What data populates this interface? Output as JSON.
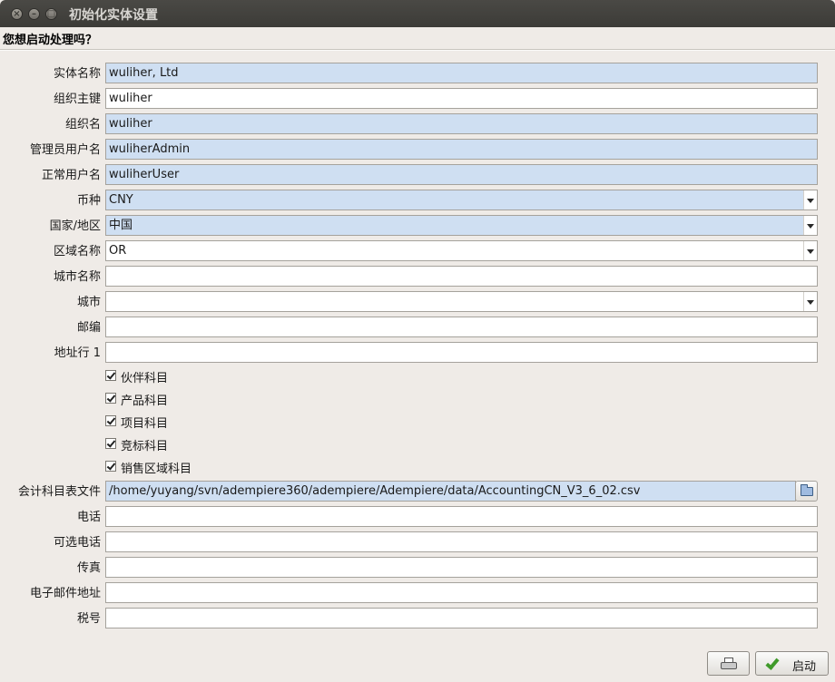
{
  "window": {
    "title": "初始化实体设置",
    "question": "您想启动处理吗？"
  },
  "form": {
    "entity_name": {
      "label": "实体名称",
      "value": "wuliher, Ltd"
    },
    "org_key": {
      "label": "组织主键",
      "value": "wuliher"
    },
    "org_name": {
      "label": "组织名",
      "value": "wuliher"
    },
    "admin_user": {
      "label": "管理员用户名",
      "value": "wuliherAdmin"
    },
    "normal_user": {
      "label": "正常用户名",
      "value": "wuliherUser"
    },
    "currency": {
      "label": "币种",
      "value": "CNY"
    },
    "country": {
      "label": "国家/地区",
      "value": "中国"
    },
    "region": {
      "label": "区域名称",
      "value": "OR"
    },
    "city_name": {
      "label": "城市名称",
      "value": ""
    },
    "city": {
      "label": "城市",
      "value": ""
    },
    "postal": {
      "label": "邮编",
      "value": ""
    },
    "address1": {
      "label": "地址行 1",
      "value": ""
    },
    "checks": [
      {
        "label": "伙伴科目",
        "checked": true
      },
      {
        "label": "产品科目",
        "checked": true
      },
      {
        "label": "项目科目",
        "checked": true
      },
      {
        "label": "竞标科目",
        "checked": true
      },
      {
        "label": "销售区域科目",
        "checked": true
      }
    ],
    "accounts_file": {
      "label": "会计科目表文件",
      "value": "/home/yuyang/svn/adempiere360/adempiere/Adempiere/data/AccountingCN_V3_6_02.csv"
    },
    "phone": {
      "label": "电话",
      "value": ""
    },
    "alt_phone": {
      "label": "可选电话",
      "value": ""
    },
    "fax": {
      "label": "传真",
      "value": ""
    },
    "email": {
      "label": "电子邮件地址",
      "value": ""
    },
    "tax_id": {
      "label": "税号",
      "value": ""
    }
  },
  "buttons": {
    "start_label": "启动"
  },
  "colors": {
    "highlight_field": "#cfdff2",
    "titlebar": "#3c3b37",
    "window_bg": "#efebe7"
  }
}
